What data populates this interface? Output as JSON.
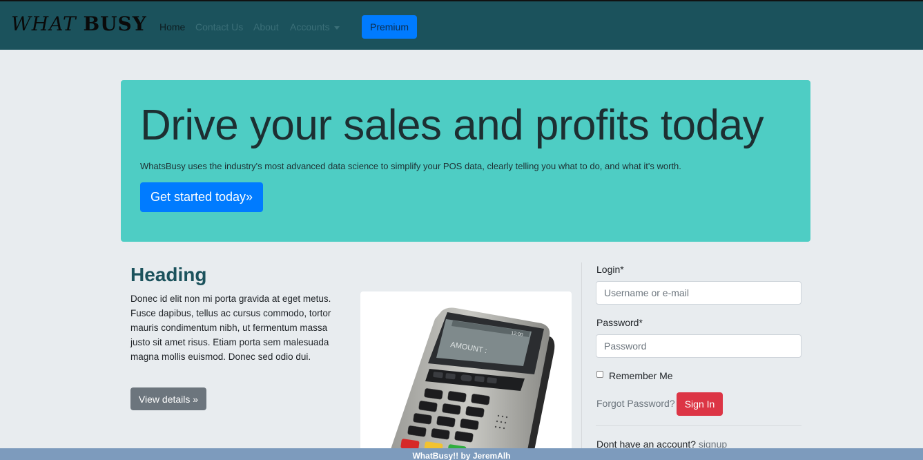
{
  "nav": {
    "brand_part1": "WHAT",
    "brand_part2": "BUSY",
    "links": [
      "Home",
      "Contact Us",
      "About",
      "Accounts"
    ],
    "premium": "Premium"
  },
  "hero": {
    "title": "Drive your sales and profits today",
    "text": "WhatsBusy uses the industry's most advanced data science to simplify your POS data, clearly telling you what to do, and what it's worth.",
    "cta": "Get started today»"
  },
  "content": {
    "heading": "Heading",
    "body": "Donec id elit non mi porta gravida at eget metus. Fusce dapibus, tellus ac cursus commodo, tortor mauris condimentum nibh, ut fermentum massa justo sit amet risus. Etiam porta sem malesuada magna mollis euismod. Donec sed odio dui.",
    "details": "View details »"
  },
  "device": {
    "screen_text": "AMOUNT  :",
    "status": "12:00"
  },
  "login": {
    "login_label": "Login*",
    "login_placeholder": "Username or e-mail",
    "password_label": "Password*",
    "password_placeholder": "Password",
    "remember": "Remember Me",
    "forgot": "Forgot Password?",
    "signin": "Sign In",
    "no_account": "Dont have an account?",
    "signup": "signup"
  },
  "footer": {
    "text": "WhatBusy!! by JeremAlh"
  }
}
